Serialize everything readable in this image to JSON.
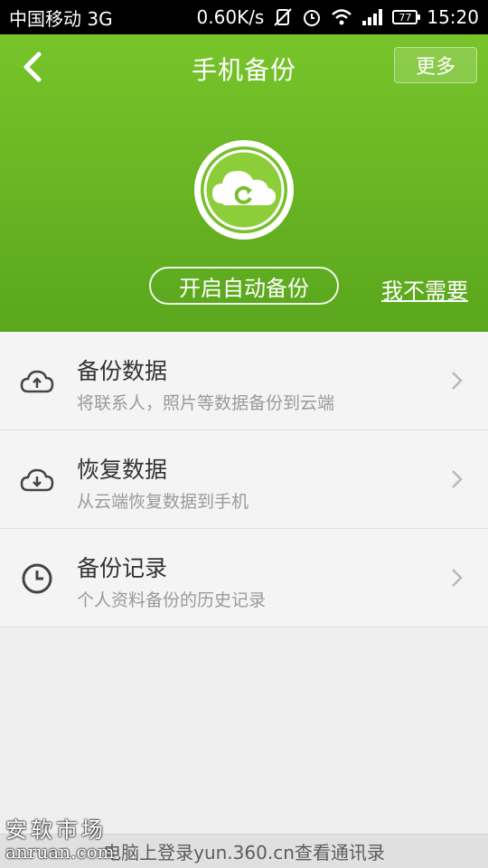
{
  "status_bar": {
    "carrier": "中国移动 3G",
    "speed": "0.60K/s",
    "battery": "77",
    "time": "15:20"
  },
  "header": {
    "title": "手机备份",
    "more_label": "更多",
    "auto_backup_label": "开启自动备份",
    "no_need_label": "我不需要"
  },
  "menu": [
    {
      "title": "备份数据",
      "subtitle": "将联系人，照片等数据备份到云端",
      "icon": "cloud-upload-icon"
    },
    {
      "title": "恢复数据",
      "subtitle": "从云端恢复数据到手机",
      "icon": "cloud-download-icon"
    },
    {
      "title": "备份记录",
      "subtitle": "个人资料备份的历史记录",
      "icon": "clock-icon"
    }
  ],
  "footer": {
    "text": "电脑上登录yun.360.cn查看通讯录"
  },
  "watermark": {
    "cn": "安软市场",
    "en": "anruan.com"
  },
  "colors": {
    "header_top": "#78c42a",
    "header_bottom": "#5aa61d",
    "list_bg": "#f4f4f4"
  }
}
